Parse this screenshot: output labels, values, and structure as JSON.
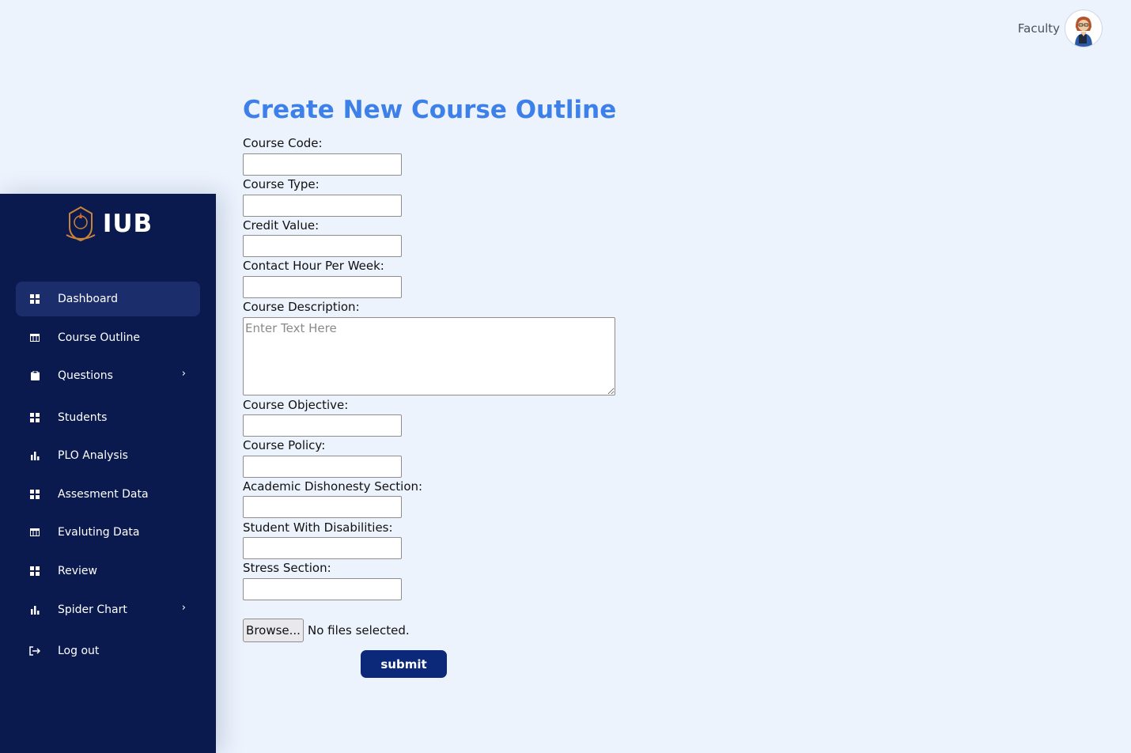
{
  "header": {
    "user_role": "Faculty"
  },
  "sidebar": {
    "brand": "IUB",
    "items": [
      {
        "label": "Dashboard",
        "icon": "grid-icon"
      },
      {
        "label": "Course Outline",
        "icon": "table-icon"
      },
      {
        "label": "Questions",
        "icon": "clipboard-icon",
        "has_submenu": true
      },
      {
        "label": "Students",
        "icon": "grid-icon"
      },
      {
        "label": "PLO Analysis",
        "icon": "bar-chart-icon"
      },
      {
        "label": "Assesment Data",
        "icon": "grid-icon"
      },
      {
        "label": "Evaluting Data",
        "icon": "table-icon"
      },
      {
        "label": "Review",
        "icon": "grid-icon"
      },
      {
        "label": "Spider Chart",
        "icon": "bar-chart-icon",
        "has_submenu": true
      },
      {
        "label": "Log out",
        "icon": "logout-icon"
      }
    ],
    "active_item": "Dashboard"
  },
  "form": {
    "title": "Create New Course Outline",
    "fields": [
      {
        "label": "Course Code:",
        "value": ""
      },
      {
        "label": "Course Type:",
        "value": ""
      },
      {
        "label": "Credit Value:",
        "value": ""
      },
      {
        "label": "Contact Hour Per Week:",
        "value": ""
      },
      {
        "label": "Course Description:",
        "value": "",
        "placeholder": "Enter Text Here"
      },
      {
        "label": "Course Objective:",
        "value": ""
      },
      {
        "label": "Course Policy:",
        "value": ""
      },
      {
        "label": "Academic Dishonesty Section:",
        "value": ""
      },
      {
        "label": "Student With Disabilities:",
        "value": ""
      },
      {
        "label": "Stress Section:",
        "value": ""
      }
    ],
    "file_button_label": "Browse...",
    "file_status": "No files selected.",
    "submit_label": "submit"
  },
  "colors": {
    "page_bg": "#ecf3fd",
    "sidebar_bg": "#0b1a4e",
    "active_item_bg": "#1b2d6b",
    "title": "#3e80ea",
    "submit_bg": "#0b2879"
  }
}
